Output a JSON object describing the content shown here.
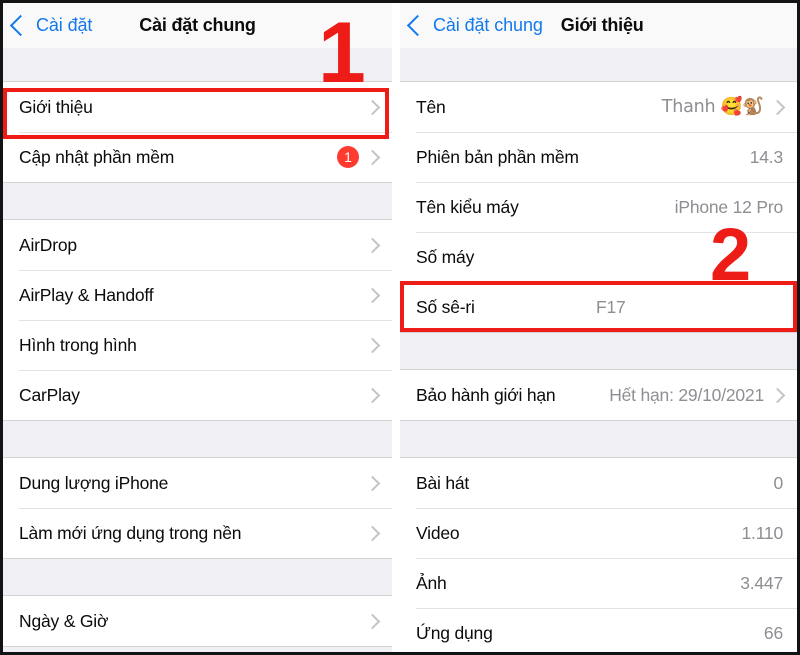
{
  "annotations": {
    "step_one": "1",
    "step_two": "2",
    "highlight_color": "#ee1c17"
  },
  "left_panel": {
    "nav": {
      "back_label": "Cài đặt",
      "title": "Cài đặt chung"
    },
    "groups": [
      {
        "rows": [
          {
            "label": "Giới thiệu",
            "value": "",
            "badge": "",
            "chevron": true
          },
          {
            "label": "Cập nhật phần mềm",
            "value": "",
            "badge": "1",
            "chevron": true
          }
        ]
      },
      {
        "rows": [
          {
            "label": "AirDrop",
            "value": "",
            "badge": "",
            "chevron": true
          },
          {
            "label": "AirPlay & Handoff",
            "value": "",
            "badge": "",
            "chevron": true
          },
          {
            "label": "Hình trong hình",
            "value": "",
            "badge": "",
            "chevron": true
          },
          {
            "label": "CarPlay",
            "value": "",
            "badge": "",
            "chevron": true
          }
        ]
      },
      {
        "rows": [
          {
            "label": "Dung lượng iPhone",
            "value": "",
            "badge": "",
            "chevron": true
          },
          {
            "label": "Làm mới ứng dụng trong nền",
            "value": "",
            "badge": "",
            "chevron": true
          }
        ]
      },
      {
        "rows": [
          {
            "label": "Ngày & Giờ",
            "value": "",
            "badge": "",
            "chevron": true
          }
        ]
      }
    ]
  },
  "right_panel": {
    "nav": {
      "back_label": "Cài đặt chung",
      "title": "Giới thiệu"
    },
    "groups": [
      {
        "rows": [
          {
            "label": "Tên",
            "value": "Thanh 🥰🐒",
            "chevron": true,
            "censored": false
          },
          {
            "label": "Phiên bản phần mềm",
            "value": "14.3",
            "chevron": false,
            "censored": false
          },
          {
            "label": "Tên kiểu máy",
            "value": "iPhone 12 Pro",
            "chevron": false,
            "censored": false
          },
          {
            "label": "Số máy",
            "value": "",
            "chevron": false,
            "censored": true
          },
          {
            "label": "Số sê-ri",
            "value": "F17",
            "chevron": false,
            "censored": false
          }
        ]
      },
      {
        "rows": [
          {
            "label": "Bảo hành giới hạn",
            "value": "Hết hạn: 29/10/2021",
            "chevron": true,
            "censored": false
          }
        ]
      },
      {
        "rows": [
          {
            "label": "Bài hát",
            "value": "0",
            "chevron": false,
            "censored": false
          },
          {
            "label": "Video",
            "value": "1.110",
            "chevron": false,
            "censored": false
          },
          {
            "label": "Ảnh",
            "value": "3.447",
            "chevron": false,
            "censored": false
          },
          {
            "label": "Ứng dụng",
            "value": "66",
            "chevron": false,
            "censored": false
          }
        ]
      }
    ]
  }
}
